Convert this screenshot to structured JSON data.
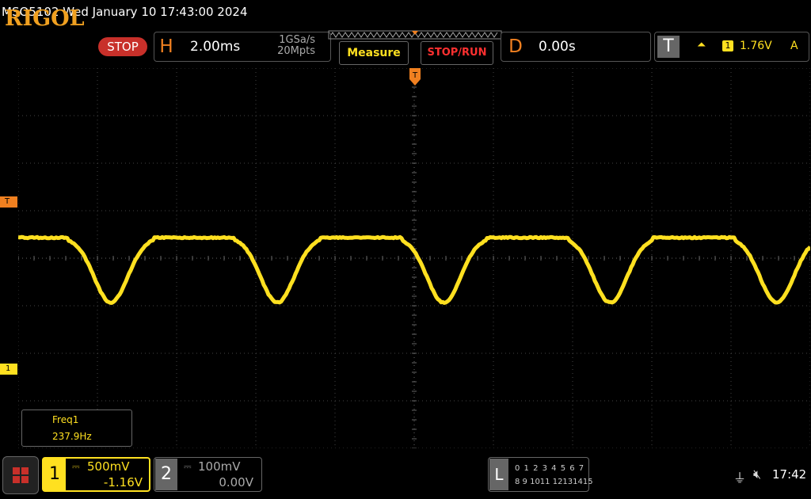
{
  "title": "MSO5102  Wed January 10 17:43:00 2024",
  "logo": "RIGOL",
  "status": "STOP",
  "horizontal": {
    "letter": "H",
    "timebase": "2.00ms",
    "sample_rate": "1GSa/s",
    "memory_depth": "20Mpts"
  },
  "buttons": {
    "measure": "Measure",
    "stop_run": "STOP/RUN"
  },
  "delay": {
    "letter": "D",
    "value": "0.00s"
  },
  "trigger": {
    "letter": "T",
    "edge_symbol": "⏶",
    "source": "1",
    "level": "1.76V",
    "mode": "A",
    "top_marker": "T",
    "level_marker": "T"
  },
  "channel_marker": "1",
  "measurement": {
    "label": "Freq1",
    "value": "237.9Hz"
  },
  "channels": [
    {
      "num": "1",
      "coupling": "⎓",
      "scale": "500mV",
      "offset": "-1.16V",
      "color": "#ffe020",
      "active": true
    },
    {
      "num": "2",
      "coupling": "⎓",
      "scale": "100mV",
      "offset": "0.00V",
      "color": "#aaaaaa",
      "active": false
    }
  ],
  "logic": {
    "letter": "L",
    "row1": "0 1 2 3  4 5 6 7",
    "row2": "8  9 1011 12131415"
  },
  "status_icons": {
    "usb": "usb-icon",
    "speaker": "speaker-muted-icon"
  },
  "clock": "17:42",
  "colors": {
    "trace": "#ffe020",
    "accent": "#f08020",
    "stop": "#c8302a",
    "grid": "#555555"
  },
  "waveform": {
    "frequency_hz": 237.9,
    "volts_per_div": 0.5,
    "time_per_div_ms": 2.0
  }
}
